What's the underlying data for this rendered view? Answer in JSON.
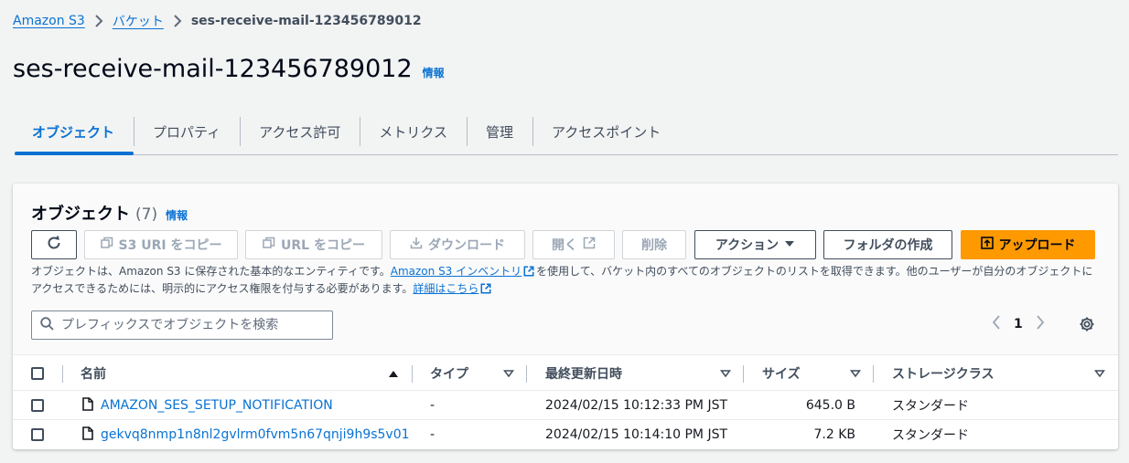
{
  "breadcrumb": {
    "items": [
      "Amazon S3",
      "バケット"
    ],
    "current": "ses-receive-mail-123456789012"
  },
  "page": {
    "title": "ses-receive-mail-123456789012",
    "info": "情報"
  },
  "tabs": [
    {
      "label": "オブジェクト",
      "active": true
    },
    {
      "label": "プロパティ",
      "active": false
    },
    {
      "label": "アクセス許可",
      "active": false
    },
    {
      "label": "メトリクス",
      "active": false
    },
    {
      "label": "管理",
      "active": false
    },
    {
      "label": "アクセスポイント",
      "active": false
    }
  ],
  "panel": {
    "title": "オブジェクト",
    "count": "(7)",
    "info": "情報",
    "buttons": {
      "copy_s3_uri": "S3 URI をコピー",
      "copy_url": "URL をコピー",
      "download": "ダウンロード",
      "open": "開く",
      "delete": "削除",
      "actions": "アクション",
      "create_folder": "フォルダの作成",
      "upload": "アップロード"
    },
    "description": {
      "part1": "オブジェクトは、Amazon S3 に保存された基本的なエンティティです。",
      "inventory_link": "Amazon S3 インベントリ",
      "part2": "を使用して、バケット内のすべてのオブジェクトのリストを取得できます。他のユーザーが自分のオブジェクトにアクセスできるためには、明示的にアクセス権限を付与する必要があります。",
      "learn_more_link": "詳細はこちら"
    },
    "search": {
      "placeholder": "プレフィックスでオブジェクトを検索",
      "value": ""
    },
    "pagination": {
      "current_page": "1"
    }
  },
  "table": {
    "columns": {
      "name": "名前",
      "type": "タイプ",
      "last_modified": "最終更新日時",
      "size": "サイズ",
      "storage_class": "ストレージクラス"
    },
    "rows": [
      {
        "name": "AMAZON_SES_SETUP_NOTIFICATION",
        "type": "-",
        "last_modified": "2024/02/15 10:12:33 PM JST",
        "size": "645.0 B",
        "storage_class": "スタンダード"
      },
      {
        "name": "gekvq8nmp1n8nl2gvlrm0fvm5n67qnji9h9s5v01",
        "type": "-",
        "last_modified": "2024/02/15 10:14:10 PM JST",
        "size": "7.2 KB",
        "storage_class": "スタンダード"
      }
    ]
  },
  "colors": {
    "link": "#0972d3",
    "primary_button": "#ff9900",
    "background": "#f2f3f3"
  }
}
